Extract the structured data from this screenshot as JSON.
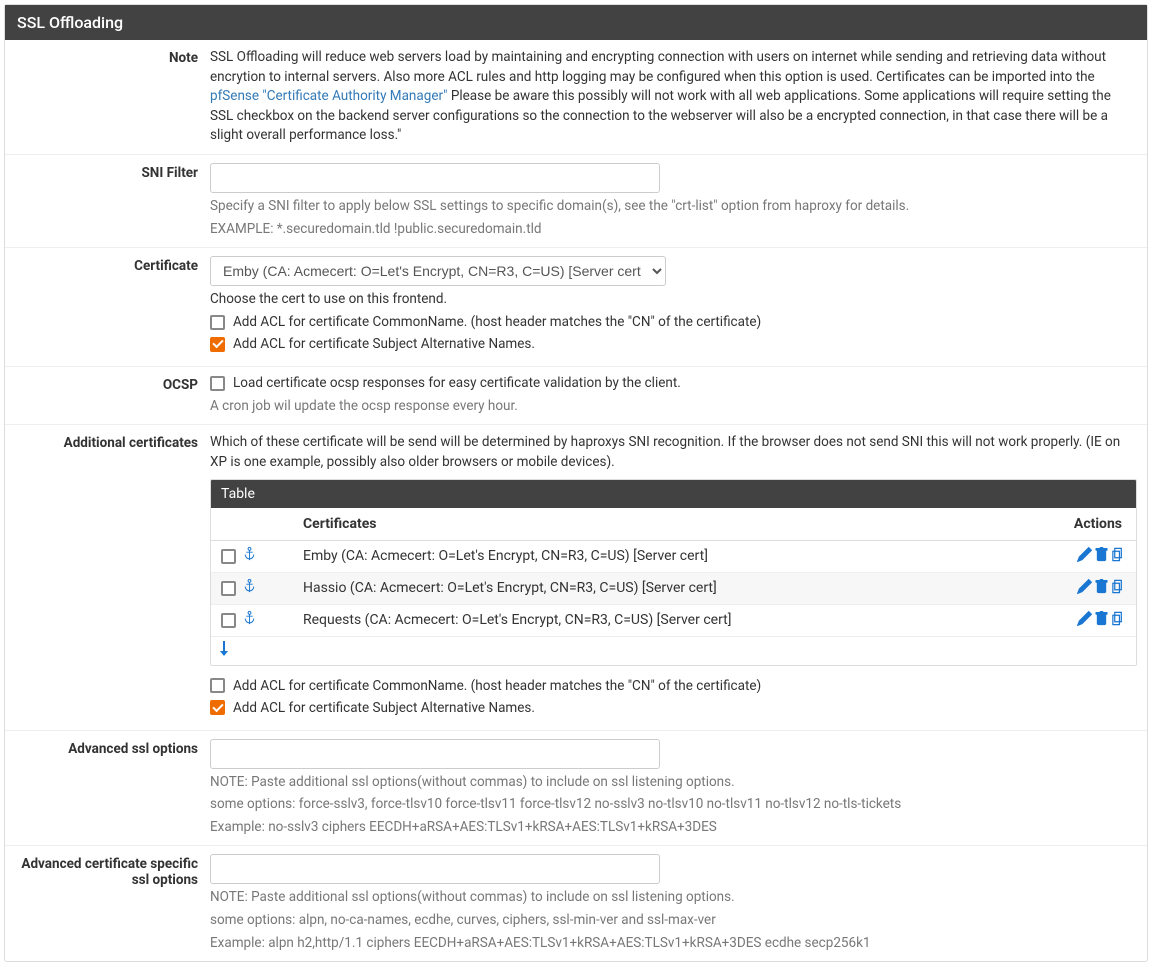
{
  "panel": {
    "title": "SSL Offloading"
  },
  "note": {
    "label": "Note",
    "text_pre": "SSL Offloading will reduce web servers load by maintaining and encrypting connection with users on internet while sending and retrieving data without encrytion to internal servers. Also more ACL rules and http logging may be configured when this option is used. Certificates can be imported into the ",
    "link_text": "pfSense \"Certificate Authority Manager\"",
    "text_post": " Please be aware this possibly will not work with all web applications. Some applications will require setting the SSL checkbox on the backend server configurations so the connection to the webserver will also be a encrypted connection, in that case there will be a slight overall performance loss.\""
  },
  "sni": {
    "label": "SNI Filter",
    "value": "",
    "help1": "Specify a SNI filter to apply below SSL settings to specific domain(s), see the \"crt-list\" option from haproxy for details.",
    "help2": "EXAMPLE: *.securedomain.tld !public.securedomain.tld"
  },
  "cert": {
    "label": "Certificate",
    "selected": "Emby (CA: Acmecert: O=Let's Encrypt, CN=R3, C=US) [Server cert]",
    "help": "Choose the cert to use on this frontend.",
    "acl_cn_label": "Add ACL for certificate CommonName. (host header matches the \"CN\" of the certificate)",
    "acl_san_label": "Add ACL for certificate Subject Alternative Names."
  },
  "ocsp": {
    "label": "OCSP",
    "cb_label": "Load certificate ocsp responses for easy certificate validation by the client.",
    "help": "A cron job wil update the ocsp response every hour."
  },
  "addcerts": {
    "label": "Additional certificates",
    "intro": "Which of these certificate will be send will be determined by haproxys SNI recognition. If the browser does not send SNI this will not work properly. (IE on XP is one example, possibly also older browsers or mobile devices).",
    "table_title": "Table",
    "col_certs": "Certificates",
    "col_actions": "Actions",
    "rows": [
      {
        "name": "Emby (CA: Acmecert: O=Let's Encrypt, CN=R3, C=US) [Server cert]"
      },
      {
        "name": "Hassio (CA: Acmecert: O=Let's Encrypt, CN=R3, C=US) [Server cert]"
      },
      {
        "name": "Requests (CA: Acmecert: O=Let's Encrypt, CN=R3, C=US) [Server cert]"
      }
    ],
    "acl_cn_label": "Add ACL for certificate CommonName. (host header matches the \"CN\" of the certificate)",
    "acl_san_label": "Add ACL for certificate Subject Alternative Names."
  },
  "advssl": {
    "label": "Advanced ssl options",
    "value": "",
    "help1": "NOTE: Paste additional ssl options(without commas) to include on ssl listening options.",
    "help2": "some options: force-sslv3, force-tlsv10 force-tlsv11 force-tlsv12 no-sslv3 no-tlsv10 no-tlsv11 no-tlsv12 no-tls-tickets",
    "help3": "Example: no-sslv3 ciphers EECDH+aRSA+AES:TLSv1+kRSA+AES:TLSv1+kRSA+3DES"
  },
  "advcertssl": {
    "label": "Advanced certificate specific ssl options",
    "value": "",
    "help1": "NOTE: Paste additional ssl options(without commas) to include on ssl listening options.",
    "help2": "some options: alpn, no-ca-names, ecdhe, curves, ciphers, ssl-min-ver and ssl-max-ver",
    "help3": "Example: alpn h2,http/1.1 ciphers EECDH+aRSA+AES:TLSv1+kRSA+AES:TLSv1+kRSA+3DES ecdhe secp256k1"
  },
  "icons": {
    "anchor": "⚓",
    "arrow_down": "↓"
  }
}
